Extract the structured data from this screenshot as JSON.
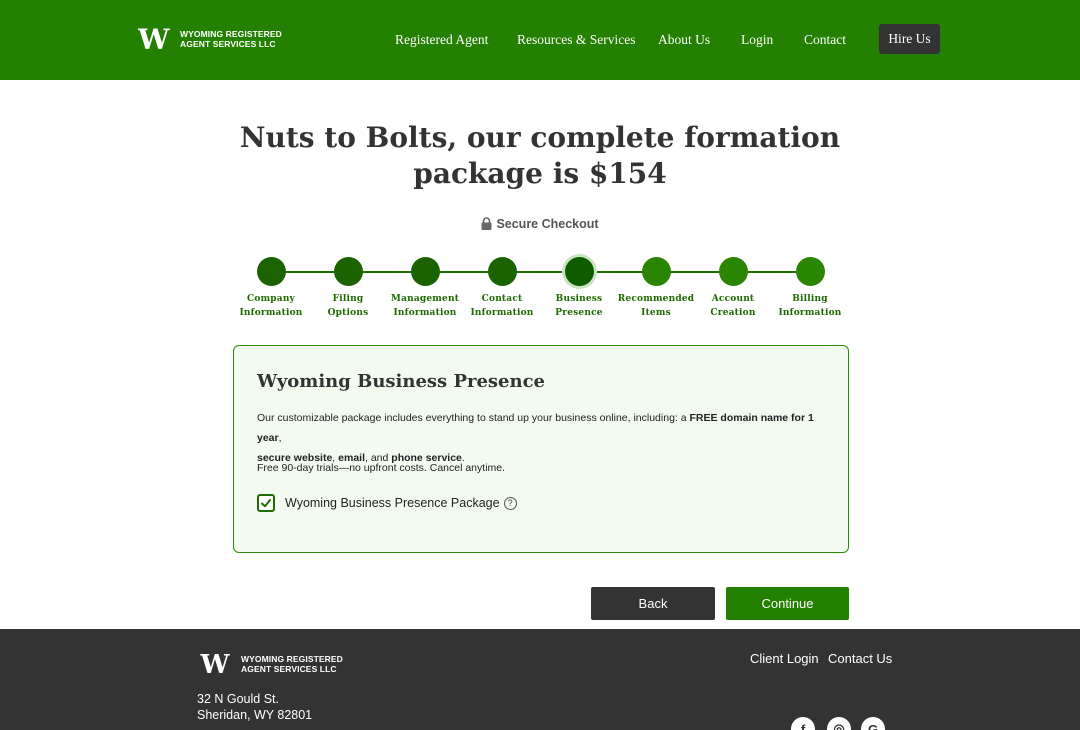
{
  "brand": {
    "name_line1": "WYOMING REGISTERED",
    "name_line2": "AGENT SERVICES LLC",
    "logo_letter": "W",
    "primary_color": "#238000",
    "dark_color": "#333333"
  },
  "nav": {
    "items": [
      "Registered Agent",
      "Resources & Services",
      "About Us",
      "Login",
      "Contact"
    ],
    "cta": "Hire Us"
  },
  "page": {
    "title": "Nuts to Bolts, our complete formation package is $154",
    "secure_label": "Secure Checkout"
  },
  "steps": [
    {
      "line1": "Company",
      "line2": "Information",
      "state": "done"
    },
    {
      "line1": "Filing",
      "line2": "Options",
      "state": "done"
    },
    {
      "line1": "Management",
      "line2": "Information",
      "state": "done"
    },
    {
      "line1": "Contact",
      "line2": "Information",
      "state": "done"
    },
    {
      "line1": "Business",
      "line2": "Presence",
      "state": "current"
    },
    {
      "line1": "Recommended",
      "line2": "Items",
      "state": "todo"
    },
    {
      "line1": "Account",
      "line2": "Creation",
      "state": "todo"
    },
    {
      "line1": "Billing",
      "line2": "Information",
      "state": "todo"
    }
  ],
  "card": {
    "heading": "Wyoming Business Presence",
    "desc_intro": "Our customizable package includes everything to stand up your business online, including: a ",
    "desc_bold1": "FREE domain name for 1 year",
    "desc_sep1": ", ",
    "desc_bold2": "secure website",
    "desc_sep2": ", ",
    "desc_bold3": "email",
    "desc_sep3": ", and ",
    "desc_bold4": "phone service",
    "desc_end": ".",
    "trial": "Free 90-day trials—no upfront costs. Cancel anytime.",
    "package_label": "Wyoming Business Presence Package",
    "package_checked": true,
    "help_glyph": "?"
  },
  "actions": {
    "back": "Back",
    "continue": "Continue"
  },
  "footer": {
    "links": [
      "Client Login",
      "Contact Us"
    ],
    "address_line1": "32 N Gould St.",
    "address_line2": "Sheridan, WY 82801",
    "social": [
      "facebook-icon",
      "instagram-icon",
      "google-icon"
    ]
  }
}
